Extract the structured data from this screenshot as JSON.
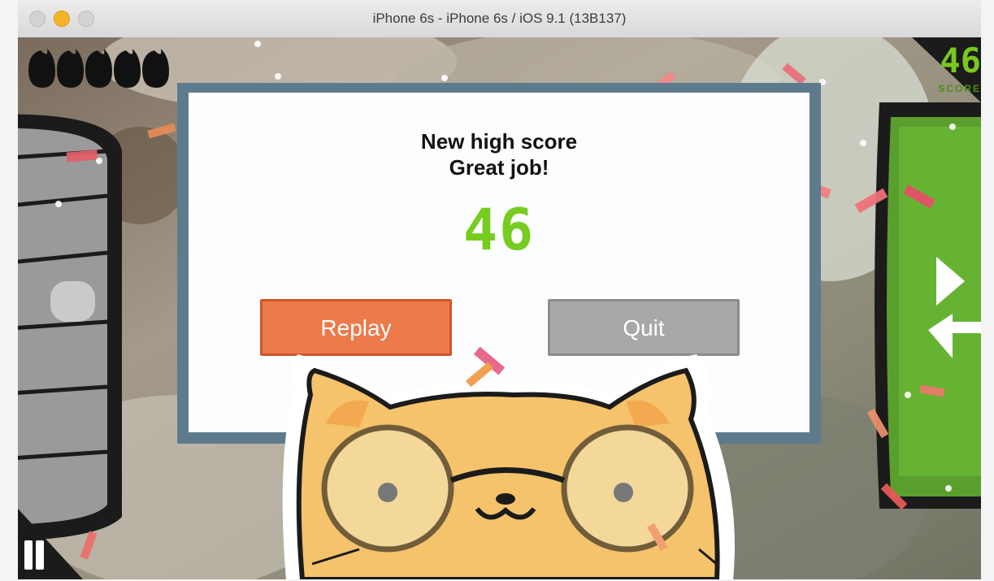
{
  "window": {
    "title": "iPhone 6s - iPhone 6s / iOS 9.1 (13B137)"
  },
  "game": {
    "hud": {
      "score": "46",
      "score_label": "SCORE",
      "lives_count": 5
    },
    "result": {
      "headline_line1": "New high score",
      "headline_line2": "Great job!",
      "score": "46"
    },
    "buttons": {
      "replay_label": "Replay",
      "quit_label": "Quit"
    }
  },
  "colors": {
    "replay_button": "#ec7a4a",
    "quit_button": "#a8a8a8",
    "score_green": "#76cc1f",
    "dialog_frame": "#5e7a8d"
  }
}
